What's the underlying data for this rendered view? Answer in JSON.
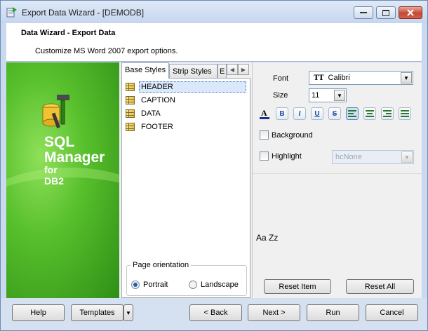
{
  "window": {
    "title": "Export Data Wizard - [DEMODB]"
  },
  "header": {
    "title": "Data Wizard - Export Data",
    "subtitle": "Customize MS Word 2007 export options."
  },
  "splash": {
    "line1": "SQL",
    "line2": "Manager",
    "line3": "for",
    "line4": "DB2"
  },
  "tabs": [
    {
      "label": "Base Styles"
    },
    {
      "label": "Strip Styles"
    },
    {
      "label": "E"
    }
  ],
  "styles": [
    {
      "label": "HEADER"
    },
    {
      "label": "CAPTION"
    },
    {
      "label": "DATA"
    },
    {
      "label": "FOOTER"
    }
  ],
  "orientation": {
    "legend": "Page orientation",
    "portrait": "Portrait",
    "landscape": "Landscape",
    "selected": "Portrait"
  },
  "format": {
    "font_label": "Font",
    "font_value": "Calibri",
    "size_label": "Size",
    "size_value": "11",
    "background_label": "Background",
    "highlight_label": "Highlight",
    "highlight_value": "hcNone"
  },
  "preview": {
    "text": "Aa Zz"
  },
  "buttons": {
    "reset_item": "Reset Item",
    "reset_all": "Reset All",
    "help": "Help",
    "templates": "Templates",
    "back": "< Back",
    "next": "Next >",
    "run": "Run",
    "cancel": "Cancel"
  }
}
